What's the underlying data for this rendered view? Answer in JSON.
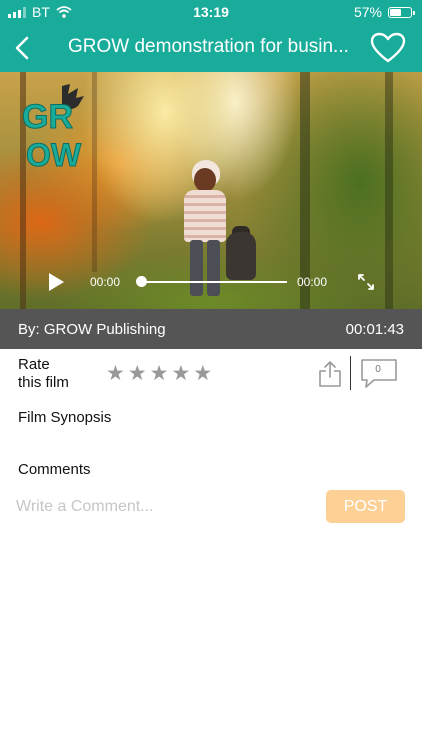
{
  "status_bar": {
    "carrier": "BT",
    "time": "13:19",
    "battery_percent": "57%",
    "battery_level": 0.57
  },
  "header": {
    "back_icon": "chevron-left-icon",
    "title": "GROW demonstration for busin...",
    "favorite_icon": "heart-outline-icon"
  },
  "video": {
    "logo_text": "GROW",
    "current_time": "00:00",
    "duration_time": "00:00",
    "progress": 0,
    "play_icon": "play-icon",
    "fullscreen_icon": "expand-icon"
  },
  "film_info": {
    "by": "By: GROW Publishing",
    "duration": "00:01:43"
  },
  "rating": {
    "label_line1": "Rate",
    "label_line2": "this film",
    "stars": [
      "★",
      "★",
      "★",
      "★",
      "★"
    ],
    "value": 0
  },
  "actions": {
    "share_icon": "share-icon",
    "comment_icon": "speech-bubble-icon",
    "comment_count": "0"
  },
  "synopsis": {
    "title": "Film Synopsis"
  },
  "comments": {
    "title": "Comments",
    "placeholder": "Write a Comment...",
    "value": "",
    "post_label": "POST"
  },
  "colors": {
    "brand": "#1aac9b",
    "info_bar": "#555555",
    "post_button": "#fdd096",
    "star": "#999999"
  }
}
